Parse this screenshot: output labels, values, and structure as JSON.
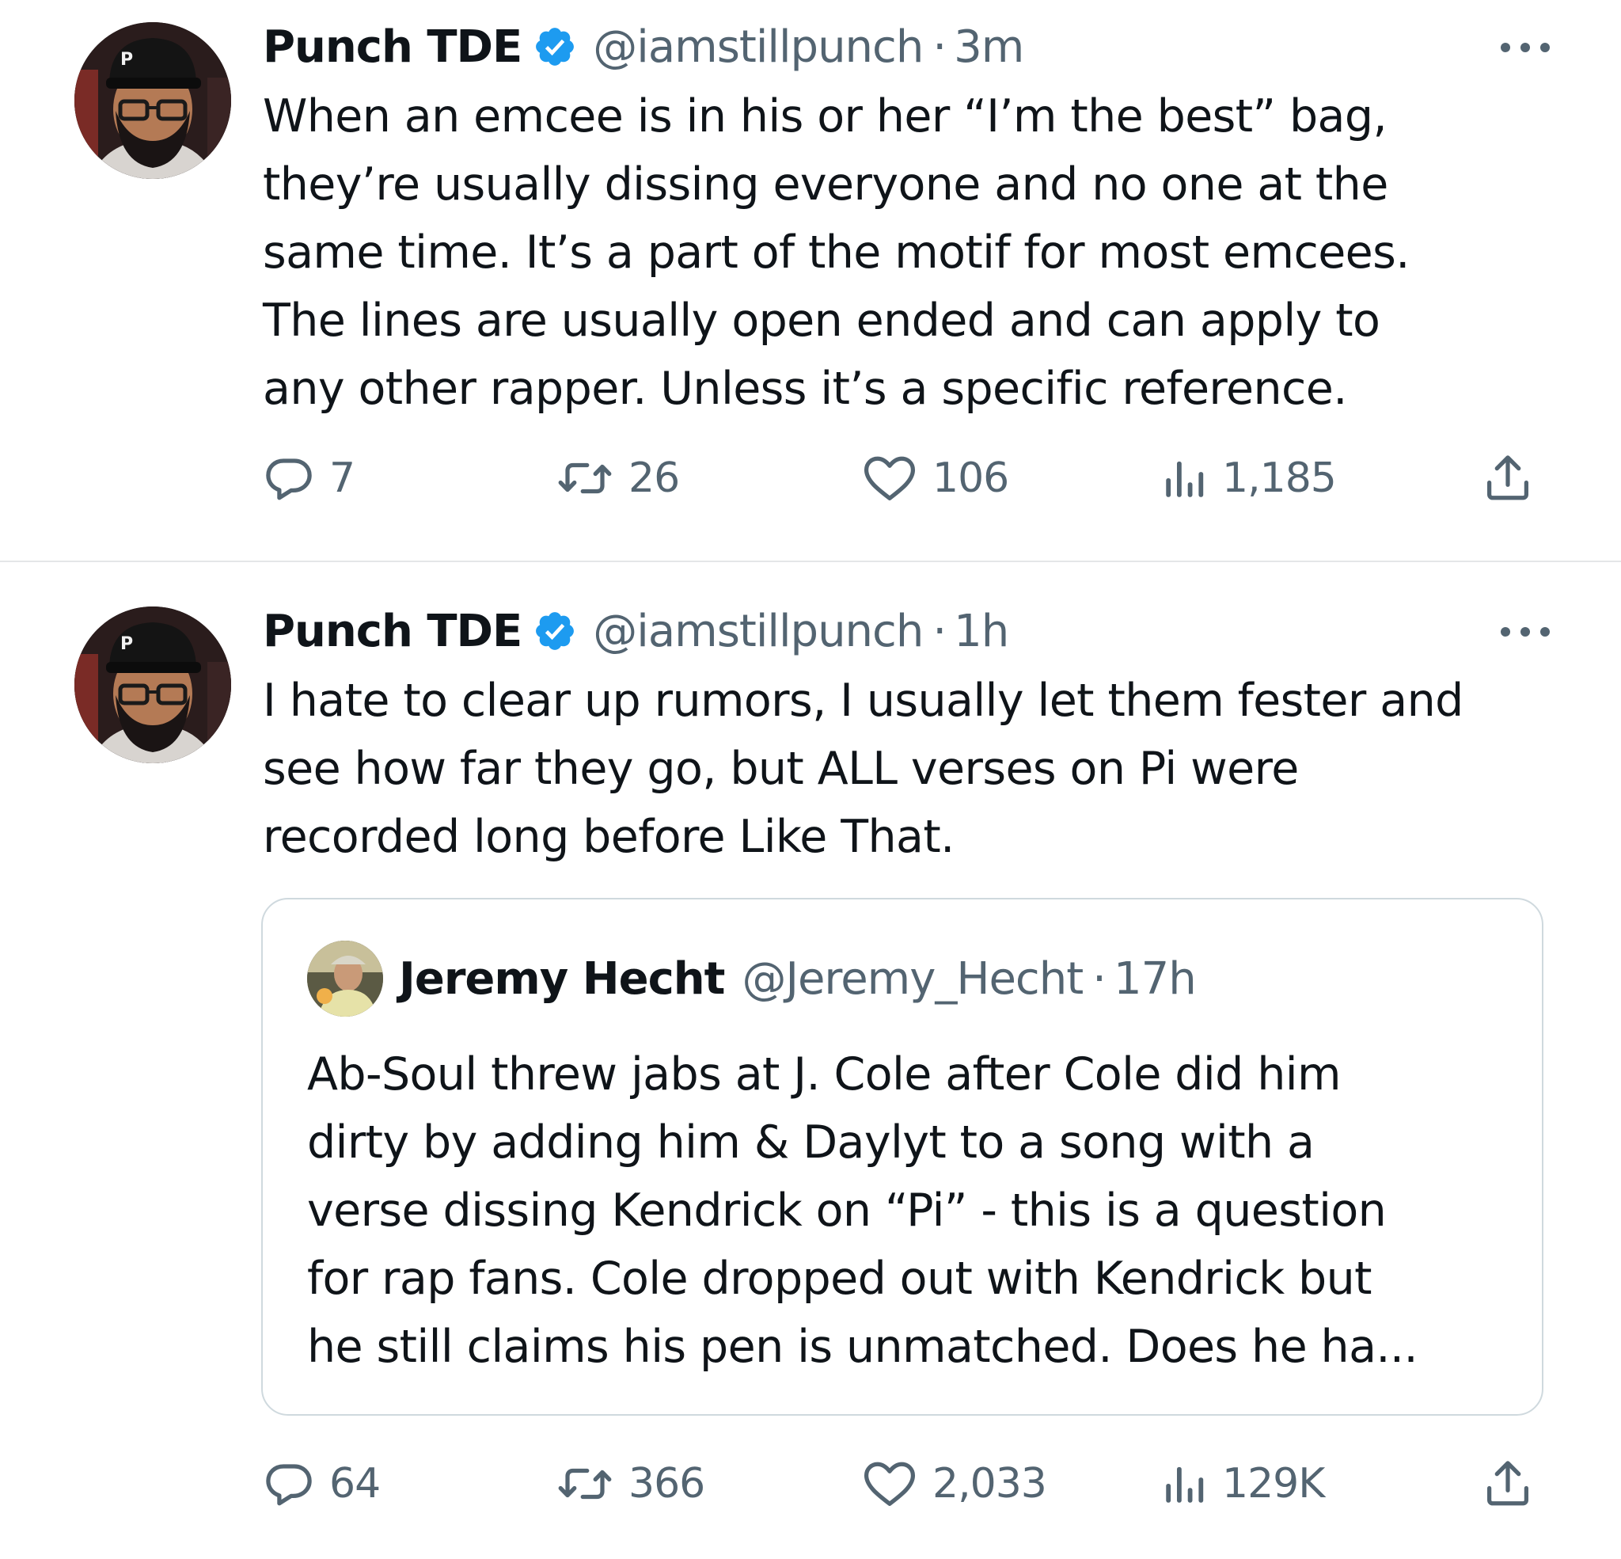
{
  "tweets": [
    {
      "author": "Punch TDE",
      "handle": "@iamstillpunch",
      "separator": "·",
      "time": "3m",
      "verified": true,
      "text_lines": [
        "When an emcee is in his or her “I’m the best” bag,",
        "they’re usually dissing everyone and no one at the",
        "same time. It’s a part of the motif for most emcees.",
        "The lines are usually open ended and can apply to",
        "any other rapper. Unless it’s a specific reference."
      ],
      "stats": {
        "replies": "7",
        "retweets": "26",
        "likes": "106",
        "views": "1,185"
      }
    },
    {
      "author": "Punch TDE",
      "handle": "@iamstillpunch",
      "separator": "·",
      "time": "1h",
      "verified": true,
      "text_lines": [
        "I hate to clear up rumors, I usually let them fester and",
        "see how far they go, but ALL verses on Pi were",
        "recorded long before Like That."
      ],
      "quote": {
        "author": "Jeremy Hecht",
        "handle": "@Jeremy_Hecht",
        "separator": "·",
        "time": "17h",
        "text_lines": [
          "Ab-Soul threw jabs at J. Cole after Cole did him",
          "dirty by adding him & Daylyt to a song with a",
          "verse dissing Kendrick on “Pi” - this is a question",
          "for rap fans. Cole dropped out with Kendrick but",
          "he still claims his pen is unmatched. Does he ha..."
        ]
      },
      "stats": {
        "replies": "64",
        "retweets": "366",
        "likes": "2,033",
        "views": "129K"
      }
    }
  ],
  "icons": {
    "verified": "verified-badge-icon",
    "more": "more-options-icon",
    "reply": "reply-icon",
    "retweet": "retweet-icon",
    "like": "heart-icon",
    "views": "views-bar-chart-icon",
    "share": "share-icon"
  },
  "colors": {
    "text_primary": "#0f1419",
    "text_secondary": "#536471",
    "verified_blue": "#1d9bf0",
    "border": "#cfd9de",
    "divider": "#e4e6e8"
  }
}
